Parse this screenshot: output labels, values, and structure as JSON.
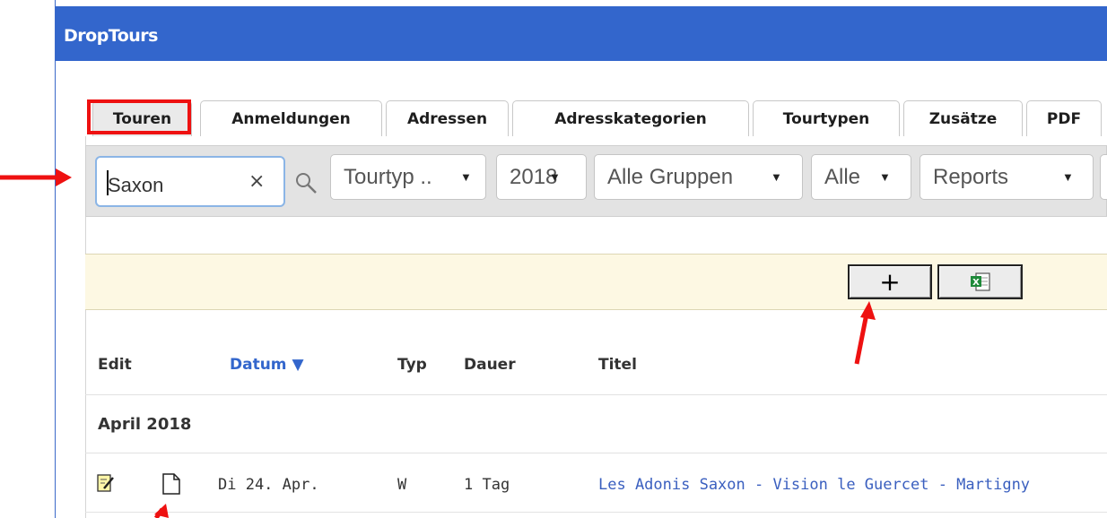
{
  "app": {
    "title": "DropTours"
  },
  "tabs": [
    {
      "label": "Touren",
      "active": true
    },
    {
      "label": "Anmeldungen"
    },
    {
      "label": "Adressen"
    },
    {
      "label": "Adresskategorien"
    },
    {
      "label": "Tourtypen"
    },
    {
      "label": "Zusätze"
    },
    {
      "label": "PDF"
    }
  ],
  "filters": {
    "search_value": "Saxon",
    "clear_label": "×",
    "tourtyp": "Tourtyp ..",
    "year": "2018",
    "groups": "Alle Gruppen",
    "all": "Alle",
    "reports": "Reports"
  },
  "toolbar": {
    "add_label": "+"
  },
  "table": {
    "headers": {
      "edit": "Edit",
      "date": "Datum ▼",
      "type": "Typ",
      "duration": "Dauer",
      "title": "Titel"
    },
    "group_label": "April 2018",
    "rows": [
      {
        "date": "Di 24. Apr.",
        "type": "W",
        "duration": "1 Tag",
        "title": "Les Adonis Saxon - Vision le Guercet - Martigny"
      }
    ]
  },
  "colors": {
    "titlebar": "#3366cc",
    "annotation": "#ee1111",
    "link": "#3a5fbf",
    "toolbar_bg": "#fdf8e3"
  },
  "icons": [
    "search-icon",
    "edit-icon",
    "document-icon",
    "excel-icon",
    "dropdown-arrow-icon"
  ]
}
